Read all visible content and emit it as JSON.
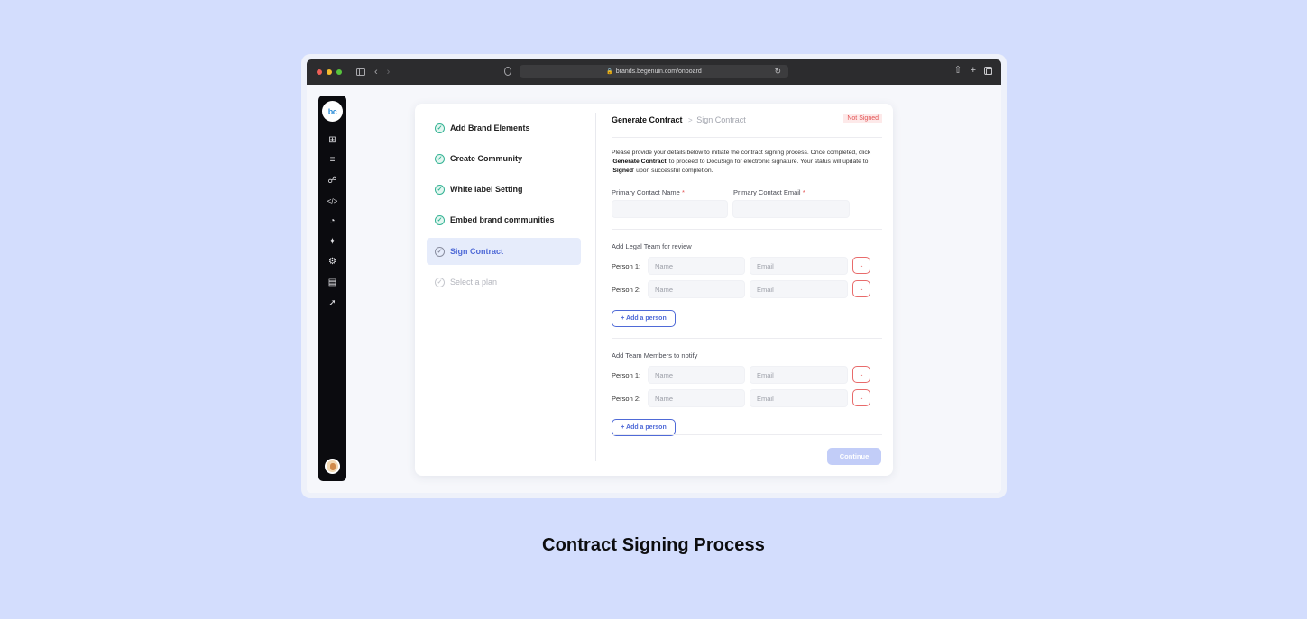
{
  "browser": {
    "url": "brands.begenuin.com/onboard",
    "traffic_lights": [
      "#ee5f57",
      "#f4bd2f",
      "#57c53d"
    ]
  },
  "app_rail": {
    "logo": "bc",
    "icons": [
      "dashboard-icon",
      "tasks-icon",
      "community-icon",
      "code-icon",
      "analytics-icon",
      "magic-wand-icon",
      "settings-icon",
      "store-icon",
      "trend-icon"
    ]
  },
  "steps": [
    {
      "label": "Add Brand Elements",
      "state": "done"
    },
    {
      "label": "Create Community",
      "state": "done"
    },
    {
      "label": "White label Setting",
      "state": "done"
    },
    {
      "label": "Embed brand communities",
      "state": "done"
    },
    {
      "label": "Sign Contract",
      "state": "active"
    },
    {
      "label": "Select a plan",
      "state": "pending"
    }
  ],
  "header": {
    "current": "Generate Contract",
    "separator": ">",
    "next": "Sign Contract",
    "status": "Not Signed"
  },
  "intro": {
    "part1": "Please provide your details below to initiate the contract signing process. Once completed, click '",
    "bold1": "Generate Contract",
    "part2": "' to proceed to DocuSign for electronic signature. Your status will update to '",
    "bold2": "Signed",
    "part3": "' upon successful completion."
  },
  "primary_contact": {
    "name_label": "Primary Contact Name",
    "email_label": "Primary Contact Email",
    "required_mark": "*"
  },
  "legal_team": {
    "title": "Add Legal Team for review",
    "people": [
      {
        "label": "Person 1:",
        "name_placeholder": "Name",
        "email_placeholder": "Email",
        "remove_label": "-"
      },
      {
        "label": "Person 2:",
        "name_placeholder": "Name",
        "email_placeholder": "Email",
        "remove_label": "-"
      }
    ],
    "add_label": "+ Add a person"
  },
  "team_members": {
    "title": "Add Team Members to notify",
    "people": [
      {
        "label": "Person 1:",
        "name_placeholder": "Name",
        "email_placeholder": "Email",
        "remove_label": "-"
      },
      {
        "label": "Person 2:",
        "name_placeholder": "Name",
        "email_placeholder": "Email",
        "remove_label": "-"
      }
    ],
    "add_label": "+ Add a person"
  },
  "continue_label": "Continue",
  "caption": "Contract Signing Process",
  "colors": {
    "background": "#d3ddfd",
    "accent": "#4f6ad7",
    "success": "#34b394",
    "danger": "#e35353"
  }
}
